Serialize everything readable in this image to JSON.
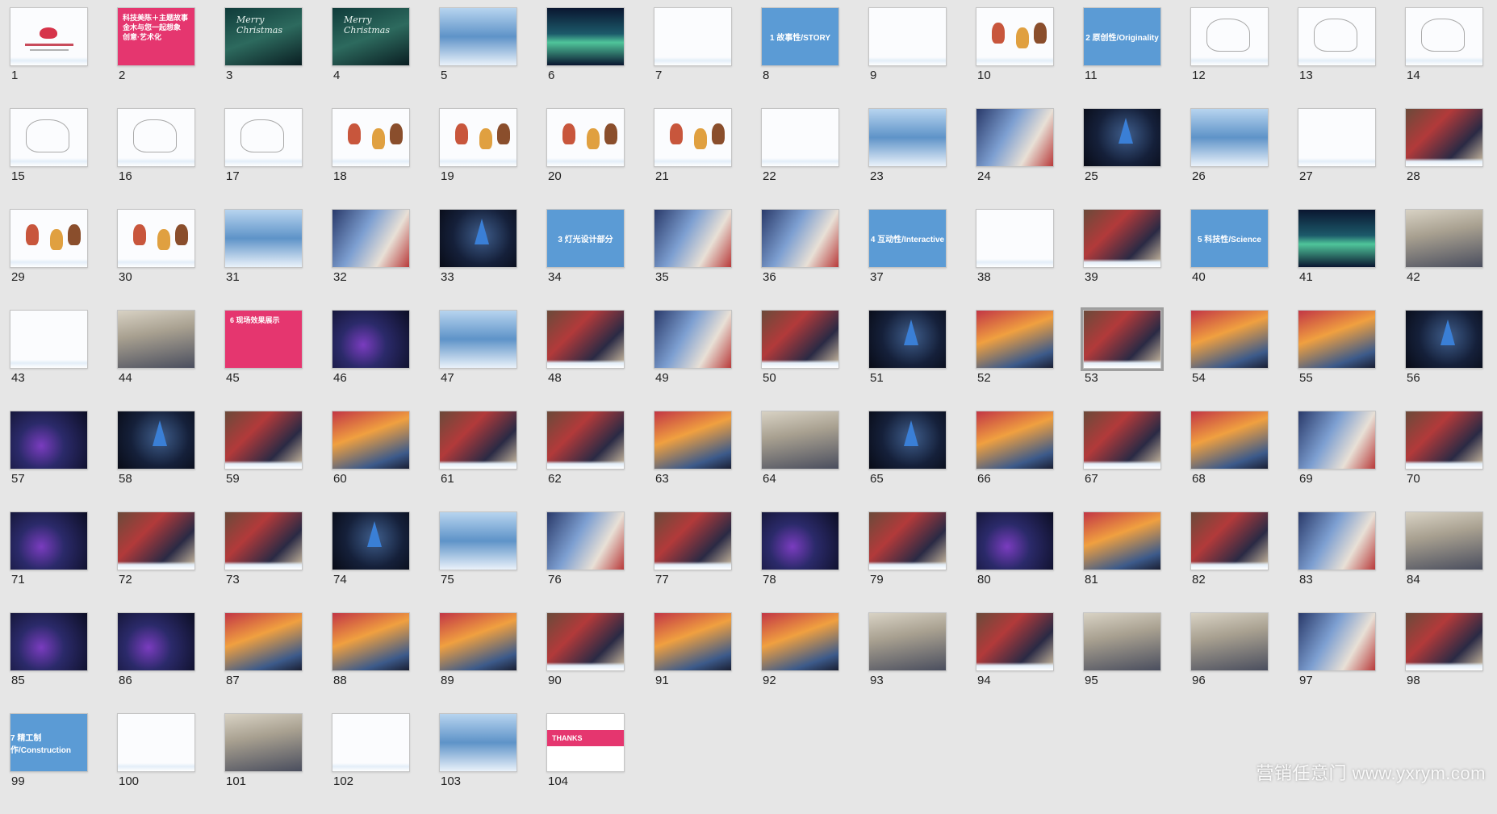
{
  "slides": [
    {
      "n": "1",
      "kind": "cover"
    },
    {
      "n": "2",
      "kind": "pink",
      "text": "科技美陈＋主题故事 金木与您一起想象 创意·艺术化"
    },
    {
      "n": "3",
      "kind": "xmas",
      "text": "Merry Christmas"
    },
    {
      "n": "4",
      "kind": "xmas",
      "text": "Merry Christmas"
    },
    {
      "n": "5",
      "kind": "ice"
    },
    {
      "n": "6",
      "kind": "aurora"
    },
    {
      "n": "7",
      "kind": "white"
    },
    {
      "n": "8",
      "kind": "blue",
      "text": "1 故事性/STORY"
    },
    {
      "n": "9",
      "kind": "white"
    },
    {
      "n": "10",
      "kind": "chars"
    },
    {
      "n": "11",
      "kind": "blue",
      "text": "2 原创性/Originality"
    },
    {
      "n": "12",
      "kind": "lines"
    },
    {
      "n": "13",
      "kind": "lines"
    },
    {
      "n": "14",
      "kind": "lines"
    },
    {
      "n": "15",
      "kind": "lines"
    },
    {
      "n": "16",
      "kind": "lines"
    },
    {
      "n": "17",
      "kind": "lines"
    },
    {
      "n": "18",
      "kind": "chars"
    },
    {
      "n": "19",
      "kind": "chars"
    },
    {
      "n": "20",
      "kind": "chars"
    },
    {
      "n": "21",
      "kind": "chars"
    },
    {
      "n": "22",
      "kind": "white"
    },
    {
      "n": "23",
      "kind": "ice"
    },
    {
      "n": "24",
      "kind": "photo3"
    },
    {
      "n": "25",
      "kind": "dark"
    },
    {
      "n": "26",
      "kind": "ice"
    },
    {
      "n": "27",
      "kind": "white"
    },
    {
      "n": "28",
      "kind": "photo"
    },
    {
      "n": "29",
      "kind": "chars"
    },
    {
      "n": "30",
      "kind": "chars"
    },
    {
      "n": "31",
      "kind": "ice"
    },
    {
      "n": "32",
      "kind": "photo3"
    },
    {
      "n": "33",
      "kind": "dark"
    },
    {
      "n": "34",
      "kind": "blue",
      "text": "3 灯光设计部分"
    },
    {
      "n": "35",
      "kind": "photo3"
    },
    {
      "n": "36",
      "kind": "photo3"
    },
    {
      "n": "37",
      "kind": "blue",
      "text": "4 互动性/Interactive"
    },
    {
      "n": "38",
      "kind": "white"
    },
    {
      "n": "39",
      "kind": "photo"
    },
    {
      "n": "40",
      "kind": "blue",
      "text": "5 科技性/Science"
    },
    {
      "n": "41",
      "kind": "aurora"
    },
    {
      "n": "42",
      "kind": "indoor"
    },
    {
      "n": "43",
      "kind": "white"
    },
    {
      "n": "44",
      "kind": "indoor"
    },
    {
      "n": "45",
      "kind": "pink",
      "text": "6 现场效果展示"
    },
    {
      "n": "46",
      "kind": "neon"
    },
    {
      "n": "47",
      "kind": "ice"
    },
    {
      "n": "48",
      "kind": "photo"
    },
    {
      "n": "49",
      "kind": "photo3"
    },
    {
      "n": "50",
      "kind": "photo"
    },
    {
      "n": "51",
      "kind": "dark"
    },
    {
      "n": "52",
      "kind": "photo2"
    },
    {
      "n": "53",
      "kind": "photo",
      "selected": true
    },
    {
      "n": "54",
      "kind": "photo2"
    },
    {
      "n": "55",
      "kind": "photo2"
    },
    {
      "n": "56",
      "kind": "dark"
    },
    {
      "n": "57",
      "kind": "neon"
    },
    {
      "n": "58",
      "kind": "dark"
    },
    {
      "n": "59",
      "kind": "photo"
    },
    {
      "n": "60",
      "kind": "photo2"
    },
    {
      "n": "61",
      "kind": "photo"
    },
    {
      "n": "62",
      "kind": "photo"
    },
    {
      "n": "63",
      "kind": "photo2"
    },
    {
      "n": "64",
      "kind": "indoor"
    },
    {
      "n": "65",
      "kind": "dark"
    },
    {
      "n": "66",
      "kind": "photo2"
    },
    {
      "n": "67",
      "kind": "photo"
    },
    {
      "n": "68",
      "kind": "photo2"
    },
    {
      "n": "69",
      "kind": "photo3"
    },
    {
      "n": "70",
      "kind": "photo"
    },
    {
      "n": "71",
      "kind": "neon"
    },
    {
      "n": "72",
      "kind": "photo"
    },
    {
      "n": "73",
      "kind": "photo"
    },
    {
      "n": "74",
      "kind": "dark"
    },
    {
      "n": "75",
      "kind": "ice"
    },
    {
      "n": "76",
      "kind": "photo3"
    },
    {
      "n": "77",
      "kind": "photo"
    },
    {
      "n": "78",
      "kind": "neon"
    },
    {
      "n": "79",
      "kind": "photo"
    },
    {
      "n": "80",
      "kind": "neon"
    },
    {
      "n": "81",
      "kind": "photo2"
    },
    {
      "n": "82",
      "kind": "photo"
    },
    {
      "n": "83",
      "kind": "photo3"
    },
    {
      "n": "84",
      "kind": "indoor"
    },
    {
      "n": "85",
      "kind": "neon"
    },
    {
      "n": "86",
      "kind": "neon"
    },
    {
      "n": "87",
      "kind": "photo2"
    },
    {
      "n": "88",
      "kind": "photo2"
    },
    {
      "n": "89",
      "kind": "photo2"
    },
    {
      "n": "90",
      "kind": "photo"
    },
    {
      "n": "91",
      "kind": "photo2"
    },
    {
      "n": "92",
      "kind": "photo2"
    },
    {
      "n": "93",
      "kind": "indoor"
    },
    {
      "n": "94",
      "kind": "photo"
    },
    {
      "n": "95",
      "kind": "indoor"
    },
    {
      "n": "96",
      "kind": "indoor"
    },
    {
      "n": "97",
      "kind": "photo3"
    },
    {
      "n": "98",
      "kind": "photo"
    },
    {
      "n": "99",
      "kind": "blue",
      "text": "7 精工制作/Construction"
    },
    {
      "n": "100",
      "kind": "white"
    },
    {
      "n": "101",
      "kind": "indoor"
    },
    {
      "n": "102",
      "kind": "white"
    },
    {
      "n": "103",
      "kind": "ice"
    },
    {
      "n": "104",
      "kind": "thanks",
      "text": "THANKS"
    }
  ],
  "watermark": "营销任意门 www.yxrym.com"
}
